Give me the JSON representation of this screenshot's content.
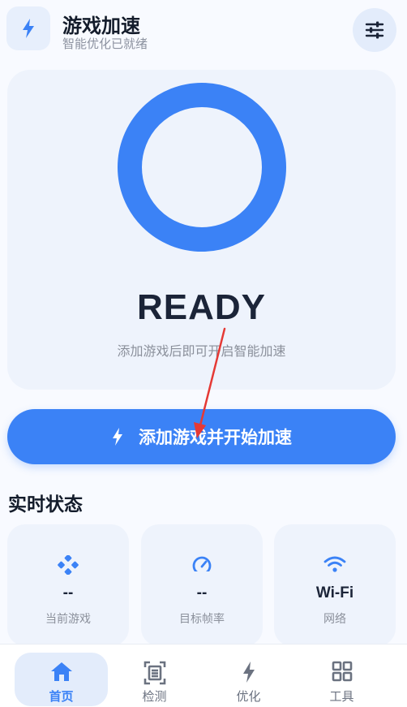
{
  "header": {
    "title": "游戏加速",
    "subtitle": "智能优化已就绪",
    "logo_icon": "lightning-icon",
    "settings_icon": "sliders-icon"
  },
  "hero": {
    "status": "READY",
    "hint": "添加游戏后即可开启智能加速"
  },
  "cta": {
    "label": "添加游戏并开始加速",
    "icon": "lightning-icon"
  },
  "realtime": {
    "title": "实时状态",
    "cards": [
      {
        "value": "--",
        "label": "当前游戏",
        "icon": "gamepad-icon"
      },
      {
        "value": "--",
        "label": "目标帧率",
        "icon": "speedometer-icon"
      },
      {
        "value": "Wi-Fi",
        "label": "网络",
        "icon": "wifi-icon"
      }
    ]
  },
  "nav": {
    "items": [
      {
        "label": "首页",
        "icon": "home-icon",
        "active": true
      },
      {
        "label": "检测",
        "icon": "scan-icon",
        "active": false
      },
      {
        "label": "优化",
        "icon": "lightning-icon",
        "active": false
      },
      {
        "label": "工具",
        "icon": "grid-icon",
        "active": false
      }
    ]
  },
  "colors": {
    "accent": "#3b82f6",
    "annotation_arrow": "#e53935"
  }
}
